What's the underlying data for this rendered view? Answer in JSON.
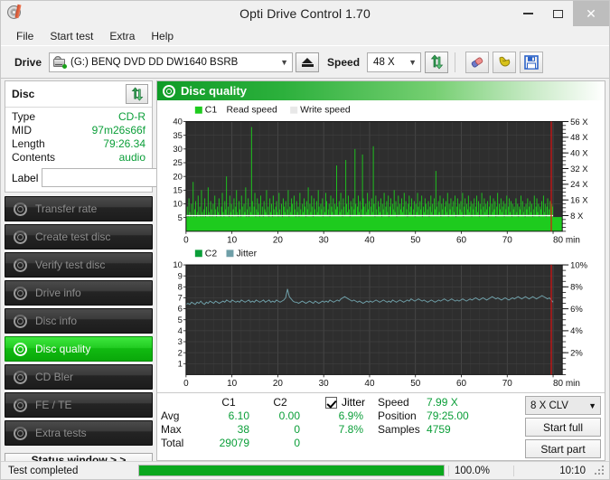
{
  "window": {
    "title": "Opti Drive Control 1.70",
    "icon": "disc-pen-icon",
    "minimize_label": "minimize",
    "maximize_label": "maximize",
    "close_label": "close"
  },
  "menu": {
    "items": [
      {
        "label": "File"
      },
      {
        "label": "Start test"
      },
      {
        "label": "Extra"
      },
      {
        "label": "Help"
      }
    ]
  },
  "toolbar": {
    "drive_label": "Drive",
    "drive_value": "(G:)   BENQ DVD DD DW1640 BSRB",
    "drive_icon": "optical-drive-icon",
    "eject_icon": "eject-icon",
    "speed_label": "Speed",
    "speed_value": "48 X",
    "refresh_icon": "refresh-arrows-icon",
    "erase_icon": "eraser-icon",
    "bookmark_icon": "bookmark-icon",
    "save_icon": "floppy-save-icon"
  },
  "disc_panel": {
    "title": "Disc",
    "refresh_icon": "refresh-arrows-icon",
    "rows": [
      {
        "key": "Type",
        "value": "CD-R"
      },
      {
        "key": "MID",
        "value": "97m26s66f"
      },
      {
        "key": "Length",
        "value": "79:26.34"
      },
      {
        "key": "Contents",
        "value": "audio"
      }
    ],
    "label_key": "Label",
    "label_value": "",
    "label_placeholder": "",
    "label_button_icon": "cd-disc-icon"
  },
  "sidebar": {
    "items": [
      {
        "label": "Transfer rate",
        "icon": "disc-icon",
        "active": false
      },
      {
        "label": "Create test disc",
        "icon": "disc-write-icon",
        "active": false
      },
      {
        "label": "Verify test disc",
        "icon": "disc-check-icon",
        "active": false
      },
      {
        "label": "Drive info",
        "icon": "disc-info-icon",
        "active": false
      },
      {
        "label": "Disc info",
        "icon": "disc-info-icon",
        "active": false
      },
      {
        "label": "Disc quality",
        "icon": "disc-quality-icon",
        "active": true
      },
      {
        "label": "CD Bler",
        "icon": "disc-icon",
        "active": false
      },
      {
        "label": "FE / TE",
        "icon": "disc-icon",
        "active": false
      },
      {
        "label": "Extra tests",
        "icon": "disc-icon",
        "active": false
      }
    ],
    "status_window_label": "Status window > >"
  },
  "main": {
    "header_title": "Disc quality",
    "header_icon": "disc-quality-icon"
  },
  "stats": {
    "col_c1": "C1",
    "col_c2": "C2",
    "row_avg": "Avg",
    "row_max": "Max",
    "row_total": "Total",
    "c1_avg": "6.10",
    "c1_max": "38",
    "c1_total": "29079",
    "c2_avg": "0.00",
    "c2_max": "0",
    "c2_total": "0",
    "jitter_label": "Jitter",
    "jitter_checked": true,
    "jitter_avg": "6.9%",
    "jitter_max": "7.8%",
    "speed_label": "Speed",
    "speed_value": "7.99 X",
    "position_label": "Position",
    "position_value": "79:25.00",
    "samples_label": "Samples",
    "samples_value": "4759",
    "clv_value": "8 X CLV",
    "start_full_label": "Start full",
    "start_part_label": "Start part"
  },
  "statusbar": {
    "text": "Test completed",
    "percent": "100.0%",
    "progress": 100,
    "time": "10:10"
  },
  "colors": {
    "c1_green": "#1ecb1e",
    "jitter_teal": "#6f9fa8",
    "read_speed_white": "#ffffff",
    "accent_green": "#0a9e38",
    "marker_red": "#e01010",
    "plot_bg": "#2e2e2e",
    "grid": "#4a4a4a"
  },
  "chart_data": [
    {
      "type": "area",
      "name": "c1-read-speed-chart",
      "title": "",
      "legend": [
        {
          "label": "C1",
          "color": "#1ecb1e",
          "swatch": true
        },
        {
          "label": "Read speed",
          "color": "#ffffff",
          "swatch": false
        },
        {
          "label": "Write speed",
          "color": "#e8e8e8",
          "swatch": true
        }
      ],
      "legend_position": "top-left",
      "grid": true,
      "xlabel": "min",
      "ylabel": "",
      "xlim": [
        0,
        82
      ],
      "ylim": [
        0,
        40
      ],
      "xticks": [
        0,
        10,
        20,
        30,
        40,
        50,
        60,
        70,
        80
      ],
      "xticklabels": [
        "0",
        "10",
        "20",
        "30",
        "40",
        "50",
        "60",
        "70",
        "80 min"
      ],
      "yticks": [
        5,
        10,
        15,
        20,
        25,
        30,
        35,
        40
      ],
      "yticklabels": [
        "5",
        "10",
        "15",
        "20",
        "25",
        "30",
        "35",
        "40"
      ],
      "y2lim": [
        0,
        56
      ],
      "y2ticks": [
        8,
        16,
        24,
        32,
        40,
        48,
        56
      ],
      "y2ticklabels": [
        "8 X",
        "16 X",
        "24 X",
        "32 X",
        "40 X",
        "48 X",
        "56 X"
      ],
      "series": [
        {
          "name": "C1",
          "color": "#1ecb1e",
          "kind": "bars",
          "x_min": 0,
          "x_max": 80,
          "values": [
            6,
            9,
            5,
            12,
            7,
            4,
            10,
            6,
            18,
            5,
            8,
            11,
            4,
            7,
            13,
            6,
            9,
            5,
            15,
            7,
            4,
            8,
            12,
            5,
            9,
            6,
            16,
            7,
            5,
            11,
            8,
            4,
            10,
            6,
            13,
            8,
            5,
            9,
            7,
            12,
            6,
            4,
            9,
            14,
            7,
            5,
            11,
            8,
            20,
            6,
            9,
            4,
            13,
            7,
            10,
            5,
            8,
            12,
            6,
            9,
            15,
            7,
            4,
            11,
            8,
            5,
            13,
            9,
            6,
            10,
            7,
            16,
            5,
            8,
            12,
            4,
            9,
            7,
            38,
            11,
            6,
            9,
            14,
            5,
            8,
            12,
            7,
            10,
            4,
            13,
            6,
            9,
            5,
            11,
            8,
            7,
            15,
            6,
            9,
            4,
            12,
            7,
            10,
            5,
            13,
            8,
            6,
            9,
            11,
            7,
            4,
            14,
            8,
            6,
            10,
            5,
            12,
            9,
            7,
            11,
            6,
            8,
            15,
            5,
            9,
            7,
            12,
            10,
            6,
            13,
            8,
            4,
            11,
            7,
            9,
            5,
            14,
            8,
            6,
            10,
            7,
            12,
            9,
            5,
            11,
            8,
            16,
            6,
            10,
            7,
            13,
            9,
            5,
            12,
            8,
            6,
            11,
            7,
            15,
            9,
            6,
            10,
            8,
            12,
            5,
            9,
            7,
            14,
            11,
            6,
            8,
            10,
            5,
            13,
            9,
            7,
            12,
            6,
            10,
            8,
            24,
            9,
            6,
            11,
            7,
            14,
            8,
            5,
            12,
            9,
            6,
            26,
            10,
            7,
            13,
            8,
            5,
            11,
            9,
            6,
            12,
            8,
            30,
            10,
            6,
            9,
            13,
            7,
            11,
            5,
            8,
            28,
            12,
            9,
            6,
            10,
            7,
            14,
            8,
            11,
            6,
            9,
            12,
            7,
            31,
            10,
            5,
            13,
            8,
            6,
            11,
            9,
            7,
            12,
            5,
            10,
            8,
            14,
            6,
            9,
            11,
            7,
            13,
            5,
            9,
            12,
            6,
            10,
            8,
            15,
            7,
            11,
            5,
            9,
            13,
            6,
            10,
            8,
            12,
            7,
            9,
            14,
            6,
            11,
            8,
            5,
            10,
            13,
            7,
            9,
            12,
            6,
            8,
            11,
            5,
            10,
            7,
            14,
            9,
            6,
            11,
            8,
            13,
            5,
            9,
            7,
            12,
            10,
            6,
            8,
            11,
            5,
            9,
            13,
            7,
            10,
            6,
            12,
            8,
            22,
            9,
            6,
            11,
            7,
            13,
            5,
            10,
            8,
            12,
            6,
            9,
            11,
            7,
            14,
            5,
            10,
            8,
            12,
            6,
            9,
            11,
            7,
            13,
            5,
            9,
            12,
            6,
            10,
            8,
            11,
            7,
            14,
            5,
            9,
            12,
            6,
            10,
            8,
            13,
            7,
            9,
            11,
            5,
            10,
            8,
            12,
            6,
            9,
            13,
            7,
            11,
            5,
            10,
            8,
            14,
            6,
            9,
            12,
            7,
            10,
            8,
            11,
            5,
            9,
            13,
            6,
            10,
            7,
            12,
            8,
            11,
            5,
            9,
            14,
            6,
            10,
            8,
            12,
            7,
            9,
            11,
            5,
            10,
            8,
            13,
            6,
            9,
            12,
            7,
            11,
            5,
            10,
            8,
            9,
            6,
            12,
            7,
            10,
            5,
            9,
            8,
            13,
            6,
            11,
            7,
            9,
            5,
            10,
            8,
            12,
            6,
            9,
            11,
            7,
            10,
            5,
            8,
            13,
            6,
            9,
            12,
            7,
            10,
            5,
            9,
            8,
            11,
            6,
            13,
            7,
            10,
            5,
            9,
            12,
            6,
            8,
            11,
            7,
            10,
            9
          ]
        },
        {
          "name": "Read speed",
          "color": "#ffffff",
          "kind": "line",
          "unit": "X",
          "description": "constant read speed rising slightly, plotted against right axis near 8 X",
          "points": [
            {
              "x": 0,
              "y": 8
            },
            {
              "x": 13,
              "y": 8
            },
            {
              "x": 80,
              "y": 8
            }
          ]
        }
      ]
    },
    {
      "type": "line",
      "name": "c2-jitter-chart",
      "title": "",
      "legend": [
        {
          "label": "C2",
          "color": "#0a9e38",
          "swatch": true
        },
        {
          "label": "Jitter",
          "color": "#6f9fa8",
          "swatch": true
        }
      ],
      "legend_position": "top-left",
      "grid": true,
      "xlabel": "min",
      "ylabel": "",
      "xlim": [
        0,
        82
      ],
      "ylim": [
        0,
        10
      ],
      "xticks": [
        0,
        10,
        20,
        30,
        40,
        50,
        60,
        70,
        80
      ],
      "xticklabels": [
        "0",
        "10",
        "20",
        "30",
        "40",
        "50",
        "60",
        "70",
        "80 min"
      ],
      "yticks": [
        1,
        2,
        3,
        4,
        5,
        6,
        7,
        8,
        9,
        10
      ],
      "yticklabels": [
        "1",
        "2",
        "3",
        "4",
        "5",
        "6",
        "7",
        "8",
        "9",
        "10"
      ],
      "y2lim": [
        0,
        10
      ],
      "y2ticks": [
        2,
        4,
        6,
        8,
        10
      ],
      "y2ticklabels": [
        "2%",
        "4%",
        "6%",
        "8%",
        "10%"
      ],
      "series": [
        {
          "name": "C2",
          "color": "#0a9e38",
          "kind": "bars",
          "values": []
        },
        {
          "name": "Jitter",
          "color": "#6f9fa8",
          "kind": "line",
          "unit": "%",
          "x_min": 0,
          "x_max": 80,
          "values": [
            6.4,
            6.5,
            6.4,
            6.6,
            6.5,
            6.4,
            6.6,
            6.5,
            6.7,
            6.5,
            6.4,
            6.6,
            6.5,
            6.7,
            6.6,
            6.5,
            6.7,
            6.6,
            6.5,
            6.6,
            6.7,
            6.6,
            6.8,
            6.7,
            6.6,
            6.8,
            6.7,
            6.6,
            6.7,
            6.6,
            6.8,
            6.7,
            6.6,
            6.7,
            6.8,
            6.6,
            6.7,
            6.6,
            6.8,
            6.7,
            6.6,
            6.7,
            6.8,
            6.6,
            6.7,
            6.8,
            6.6,
            6.7,
            6.6,
            6.8,
            6.7,
            6.6,
            6.7,
            6.8,
            7.0,
            7.8,
            7.1,
            6.9,
            6.7,
            6.6,
            6.6,
            6.5,
            6.6,
            6.7,
            6.6,
            6.5,
            6.6,
            6.7,
            6.6,
            6.5,
            6.7,
            6.6,
            6.5,
            6.6,
            6.7,
            6.6,
            6.7,
            6.6,
            6.8,
            6.7,
            6.6,
            6.7,
            6.8,
            6.7,
            6.9,
            7.0,
            7.1,
            7.0,
            6.9,
            6.8,
            6.7,
            6.8,
            6.7,
            6.6,
            6.7,
            6.6,
            6.5,
            6.6,
            6.7,
            6.6,
            6.7,
            6.6,
            6.7,
            6.8,
            6.7,
            6.6,
            6.7,
            6.8,
            6.7,
            6.6,
            6.7,
            6.6,
            6.8,
            6.7,
            6.6,
            6.7,
            6.8,
            6.7,
            6.6,
            6.7,
            6.8,
            6.7,
            6.9,
            6.8,
            6.7,
            6.8,
            6.9,
            6.8,
            6.7,
            6.8,
            6.7,
            6.6,
            6.7,
            6.8,
            6.7,
            6.6,
            6.7,
            6.8,
            6.7,
            6.8,
            6.9,
            6.8,
            6.7,
            6.8,
            6.9,
            6.8,
            6.7,
            6.8,
            6.7,
            6.8,
            6.9,
            6.8,
            6.7,
            6.8,
            6.9,
            6.8,
            6.9,
            7.0,
            6.9,
            6.8,
            6.9,
            7.0,
            6.9,
            6.8,
            6.9,
            7.0,
            7.1,
            7.0,
            6.9,
            7.0,
            6.9,
            6.8,
            6.9,
            7.0,
            6.9,
            6.8,
            6.9,
            7.0,
            6.9,
            7.0,
            7.1,
            7.0,
            6.9,
            7.0,
            7.1,
            7.0,
            6.9,
            7.0,
            7.1,
            7.0,
            6.9,
            7.0,
            7.1,
            7.2,
            7.1,
            7.0,
            6.9,
            7.0,
            6.8,
            6.6
          ]
        }
      ]
    }
  ]
}
